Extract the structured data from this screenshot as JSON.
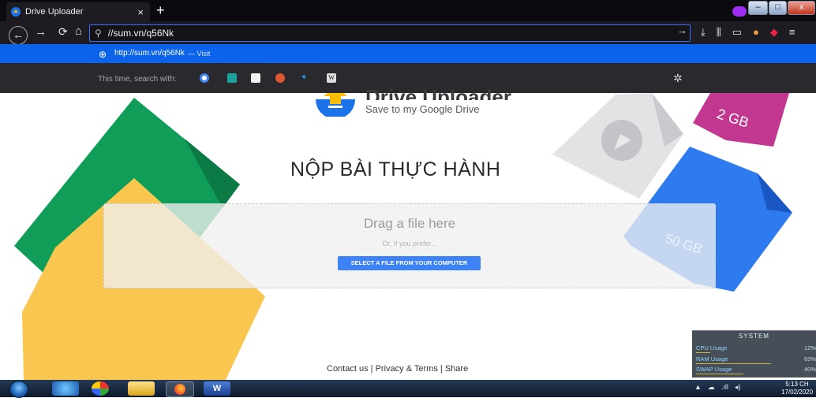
{
  "browser": {
    "tab_title": "Drive Uploader",
    "tab_close": "×",
    "new_tab": "+",
    "url": "//sum.vn/q56Nk",
    "suggestion_url": "http://sum.vn/q56Nk",
    "suggestion_action": "— Visit",
    "search_with_label": "This time, search with:",
    "search_engines": [
      "google-icon",
      "bing-icon",
      "amazon-icon",
      "duckduckgo-icon",
      "twitter-icon",
      "wikipedia-icon"
    ],
    "accent": "#0a63e8"
  },
  "page": {
    "brand_title": "Drive Uploader",
    "brand_subtitle": "Save to my Google Drive",
    "heading": "NỘP BÀI THỰC HÀNH",
    "drop_title": "Drag a file here",
    "drop_or": "Or, if you prefer...",
    "select_button": "SELECT A FILE FROM YOUR COMPUTER",
    "label_2gb": "2 GB",
    "label_50gb": "50 GB",
    "footer": {
      "contact": "Contact us",
      "privacy": "Privacy & Terms",
      "share": "Share",
      "sep": "|"
    },
    "colors": {
      "button": "#3e82f7",
      "green": "#0f9d58",
      "yellow": "#f9c74f",
      "blue": "#2e7bf0",
      "magenta": "#c2378f"
    }
  },
  "system_widget": {
    "title": "SYSTEM",
    "rows": [
      {
        "label": "CPU Usage",
        "value": "12%"
      },
      {
        "label": "RAM Usage",
        "value": "63%"
      },
      {
        "label": "SWAP Usage",
        "value": "40%"
      }
    ],
    "levels": [
      0.12,
      0.63,
      0.4
    ]
  },
  "taskbar": {
    "apps": [
      "ie-icon",
      "paint-icon",
      "explorer-icon",
      "firefox-icon",
      "word-icon"
    ],
    "time": "5:13 CH",
    "date": "17/02/2020"
  }
}
